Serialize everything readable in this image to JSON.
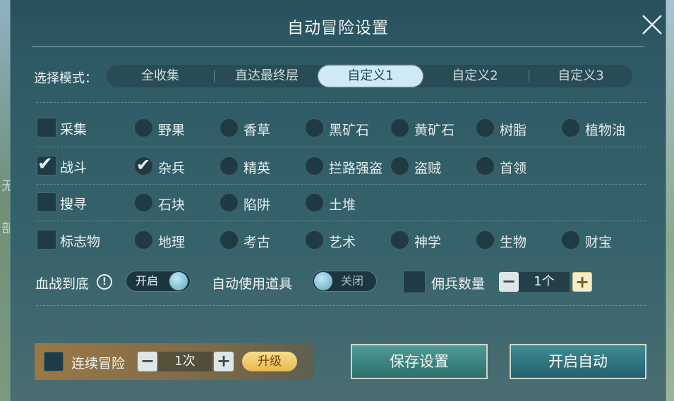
{
  "background": {
    "edge_text_1": "无",
    "edge_text_2": "部"
  },
  "title": "自动冒险设置",
  "mode": {
    "label": "选择模式：",
    "tabs": [
      "全收集",
      "直达最终层",
      "自定义1",
      "自定义2",
      "自定义3"
    ],
    "active": "自定义1"
  },
  "categories": [
    {
      "label": "采集",
      "checked": false,
      "options": [
        {
          "label": "野果",
          "checked": false
        },
        {
          "label": "香草",
          "checked": false
        },
        {
          "label": "黑矿石",
          "checked": false
        },
        {
          "label": "黄矿石",
          "checked": false
        },
        {
          "label": "树脂",
          "checked": false
        },
        {
          "label": "植物油",
          "checked": false
        }
      ]
    },
    {
      "label": "战斗",
      "checked": true,
      "options": [
        {
          "label": "杂兵",
          "checked": true
        },
        {
          "label": "精英",
          "checked": false
        },
        {
          "label": "拦路强盗",
          "checked": false
        },
        {
          "label": "盗贼",
          "checked": false
        },
        {
          "label": "首领",
          "checked": false
        }
      ]
    },
    {
      "label": "搜寻",
      "checked": false,
      "options": [
        {
          "label": "石块",
          "checked": false
        },
        {
          "label": "陷阱",
          "checked": false
        },
        {
          "label": "土堆",
          "checked": false
        }
      ]
    },
    {
      "label": "标志物",
      "checked": false,
      "options": [
        {
          "label": "地理",
          "checked": false
        },
        {
          "label": "考古",
          "checked": false
        },
        {
          "label": "艺术",
          "checked": false
        },
        {
          "label": "神学",
          "checked": false
        },
        {
          "label": "生物",
          "checked": false
        },
        {
          "label": "财宝",
          "checked": false
        }
      ]
    }
  ],
  "settings": {
    "fight_label": "血战到底",
    "info_icon": "!",
    "fight_toggle": "开启",
    "items_label": "自动使用道具",
    "items_toggle": "关闭",
    "mercenary_label": "佣兵数量",
    "mercenary_value": "1个",
    "minus": "−",
    "plus": "+"
  },
  "bottom": {
    "continuous_label": "连续冒险",
    "continuous_value": "1次",
    "upgrade": "升级",
    "save": "保存设置",
    "start": "开启自动"
  },
  "colors": {
    "accent": "#cdeaf5",
    "upgrade": "#f0c860",
    "panel": "#2e5a65"
  }
}
